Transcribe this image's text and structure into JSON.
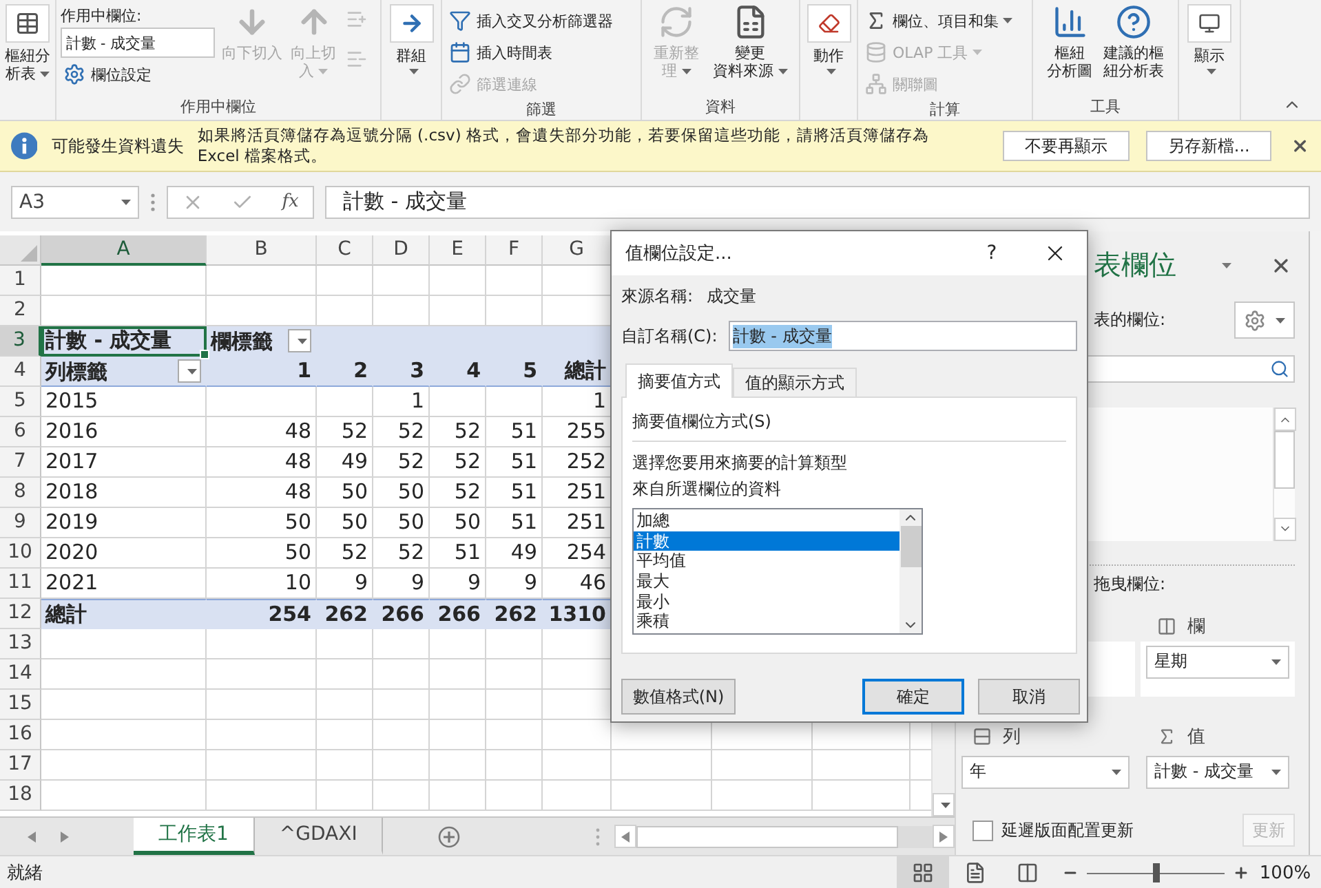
{
  "ribbon": {
    "pivot_table": {
      "lines": [
        "樞紐分",
        "析表"
      ]
    },
    "active_field": {
      "title": "作用中欄位",
      "caption": "作用中欄位:",
      "value": "計數 - 成交量",
      "settings": "欄位設定",
      "drill_down": {
        "lines": [
          "向下切入"
        ],
        "disabled": true
      },
      "drill_up": {
        "lines": [
          "向上切",
          "入"
        ],
        "disabled": true
      },
      "expand": {
        "disabled": true
      },
      "collapse": {
        "disabled": true
      }
    },
    "group": {
      "label": "群組"
    },
    "filter": {
      "title": "篩選",
      "items": [
        {
          "label": "插入交叉分析篩選器",
          "disabled": false
        },
        {
          "label": "插入時間表",
          "disabled": false
        },
        {
          "label": "篩選連線",
          "disabled": true
        }
      ]
    },
    "data": {
      "title": "資料",
      "items": [
        {
          "lines": [
            "重新整",
            "理"
          ],
          "disabled": true
        },
        {
          "lines": [
            "變更",
            "資料來源"
          ],
          "disabled": false
        }
      ]
    },
    "actions": {
      "label": "動作"
    },
    "calculations": {
      "title": "計算",
      "items": [
        {
          "label": "欄位、項目和集",
          "disabled": false
        },
        {
          "label": "OLAP 工具",
          "disabled": true
        },
        {
          "label": "關聯圖",
          "disabled": true
        }
      ]
    },
    "tools": {
      "title": "工具",
      "items": [
        {
          "lines": [
            "樞紐",
            "分析圖"
          ]
        },
        {
          "lines": [
            "建議的樞",
            "紐分析表"
          ]
        }
      ]
    },
    "show": {
      "label": "顯示"
    }
  },
  "info_bar": {
    "title": "可能發生資料遺失",
    "message": "如果將活頁簿儲存為逗號分隔 (.csv) 格式，會遺失部分功能，若要保留這些功能，請將活頁簿儲存為 Excel 檔案格式。",
    "buttons": [
      "不要再顯示",
      "另存新檔..."
    ]
  },
  "formula_bar": {
    "name_box": "A3",
    "function_symbol": "fx",
    "formula": "計數 - 成交量"
  },
  "sheet": {
    "columns": [
      {
        "label": "A",
        "selected": true
      },
      {
        "label": "B",
        "selected": false
      },
      {
        "label": "C",
        "selected": false
      },
      {
        "label": "D",
        "selected": false
      },
      {
        "label": "E",
        "selected": false
      },
      {
        "label": "F",
        "selected": false
      },
      {
        "label": "G",
        "selected": false
      }
    ],
    "rows": [
      {
        "label": "1",
        "selected": false
      },
      {
        "label": "2",
        "selected": false
      },
      {
        "label": "3",
        "selected": true
      },
      {
        "label": "4",
        "selected": false
      },
      {
        "label": "5",
        "selected": false
      },
      {
        "label": "6",
        "selected": false
      },
      {
        "label": "7",
        "selected": false
      },
      {
        "label": "8",
        "selected": false
      },
      {
        "label": "9",
        "selected": false
      },
      {
        "label": "10",
        "selected": false
      },
      {
        "label": "11",
        "selected": false
      },
      {
        "label": "12",
        "selected": false
      },
      {
        "label": "13",
        "selected": false
      },
      {
        "label": "14",
        "selected": false
      },
      {
        "label": "15",
        "selected": false
      },
      {
        "label": "16",
        "selected": false
      },
      {
        "label": "17",
        "selected": false
      },
      {
        "label": "18",
        "selected": false
      }
    ]
  },
  "pivot": {
    "value_label": {
      "text": "計數 - 成交量",
      "selected": true
    },
    "column_label": "欄標籤",
    "row_label": "列標籤",
    "column_keys": [
      "1",
      "2",
      "3",
      "4",
      "5"
    ],
    "total_header": "總計",
    "rows": [
      {
        "label": "2015",
        "cells": [
          null,
          null,
          "1",
          null,
          null
        ],
        "total": "1"
      },
      {
        "label": "2016",
        "cells": [
          "48",
          "52",
          "52",
          "52",
          "51"
        ],
        "total": "255"
      },
      {
        "label": "2017",
        "cells": [
          "48",
          "49",
          "52",
          "52",
          "51"
        ],
        "total": "252"
      },
      {
        "label": "2018",
        "cells": [
          "48",
          "50",
          "50",
          "52",
          "51"
        ],
        "total": "251"
      },
      {
        "label": "2019",
        "cells": [
          "50",
          "50",
          "50",
          "50",
          "51"
        ],
        "total": "251"
      },
      {
        "label": "2020",
        "cells": [
          "50",
          "52",
          "52",
          "51",
          "49"
        ],
        "total": "254"
      },
      {
        "label": "2021",
        "cells": [
          "10",
          "9",
          "9",
          "9",
          "9"
        ],
        "total": "46"
      }
    ],
    "grand_total": {
      "label": "總計",
      "cells": [
        "254",
        "262",
        "266",
        "266",
        "262"
      ],
      "total": "1310"
    }
  },
  "sheet_tabs": [
    {
      "label": "工作表1",
      "selected": true
    },
    {
      "label": "^GDAXI",
      "selected": false
    }
  ],
  "field_pane": {
    "title": "表欄位",
    "fields_caption": "表的欄位:",
    "drag_caption": "拖曳欄位:",
    "areas": [
      {
        "kind": "columns",
        "label": "欄",
        "value": "星期"
      },
      {
        "kind": "rows",
        "label": "列",
        "value": "年"
      },
      {
        "kind": "values",
        "label": "值",
        "value": "計數 - 成交量"
      }
    ],
    "defer": {
      "label": "延遲版面配置更新",
      "checked": false
    },
    "update": {
      "label": "更新",
      "disabled": true
    }
  },
  "dialog": {
    "title": "值欄位設定...",
    "help": "?",
    "source_label": "來源名稱:",
    "source_value": "成交量",
    "custom_label": "自訂名稱(C):",
    "custom_value": "計數 - 成交量",
    "tabs": [
      {
        "label": "摘要值方式",
        "selected": true
      },
      {
        "label": "值的顯示方式",
        "selected": false
      }
    ],
    "section": "摘要值欄位方式(S)",
    "description": [
      "選擇您要用來摘要的計算類型",
      "來自所選欄位的資料"
    ],
    "functions": [
      {
        "label": "加總",
        "selected": false
      },
      {
        "label": "計數",
        "selected": true
      },
      {
        "label": "平均值",
        "selected": false
      },
      {
        "label": "最大",
        "selected": false
      },
      {
        "label": "最小",
        "selected": false
      },
      {
        "label": "乘積",
        "selected": false
      }
    ],
    "buttons": [
      {
        "label": "數值格式(N)",
        "default": false
      },
      {
        "label": "確定",
        "default": true
      },
      {
        "label": "取消",
        "default": false
      }
    ]
  },
  "status_bar": {
    "text": "就緒",
    "views": [
      {
        "selected": true
      },
      {
        "selected": false
      },
      {
        "selected": false
      }
    ],
    "zoom": {
      "level": 0.5,
      "label": "100%"
    }
  }
}
